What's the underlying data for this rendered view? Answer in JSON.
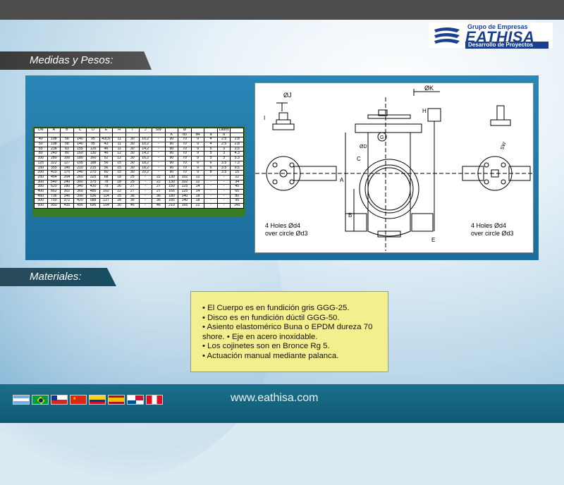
{
  "brand": {
    "group": "Grupo de Empresas",
    "name": "EATHISA",
    "sub": "Desarrollo de Proyectos"
  },
  "sections": {
    "medidas": "Medidas y Pesos:",
    "materiales": "Materiales:"
  },
  "table": {
    "headers1": [
      "DN",
      "A",
      "B",
      "C",
      "D",
      "E",
      "H",
      "I",
      "J",
      "SW",
      "",
      "Ø",
      "",
      "",
      "Lados",
      "",
      "Peso"
    ],
    "headers2": [
      "",
      "",
      "",
      "",
      "",
      "",
      "",
      "",
      "",
      "",
      "K",
      "d3",
      "d4",
      "a",
      "b",
      ""
    ],
    "rows": [
      [
        "40",
        "198",
        "58",
        "140",
        "95",
        "43(3)",
        "11",
        "30",
        "10,2",
        "-",
        "90",
        "70",
        "9",
        "4",
        "2.5",
        "2.8"
      ],
      [
        "50",
        "198",
        "58",
        "140",
        "95",
        "43",
        "11",
        "30",
        "10,2",
        "-",
        "90",
        "70",
        "9",
        "4",
        "2.5",
        "2.8"
      ],
      [
        "65",
        "238",
        "83",
        "155",
        "126",
        "46",
        "11",
        "30",
        "14,2",
        "-",
        "90",
        "70",
        "9",
        "5",
        "3",
        "3.5"
      ],
      [
        "80",
        "240",
        "80",
        "160",
        "130",
        "46",
        "12",
        "30",
        "14,2",
        "-",
        "90",
        "70",
        "9",
        "5",
        "3",
        "4.3"
      ],
      [
        "100",
        "280",
        "100",
        "180",
        "160",
        "52",
        "12",
        "30",
        "16,2",
        "-",
        "90",
        "70",
        "9",
        "5",
        "3",
        "5.3"
      ],
      [
        "125",
        "322",
        "127",
        "195",
        "188",
        "56",
        "15",
        "30",
        "18,2",
        "-",
        "90",
        "70",
        "9",
        "6",
        "3.5",
        "7.3"
      ],
      [
        "150",
        "355",
        "145",
        "210",
        "215",
        "56",
        "15",
        "30",
        "18,2",
        "-",
        "90",
        "70",
        "9",
        "6",
        "3.5",
        "9.5"
      ],
      [
        "200",
        "410",
        "170",
        "240",
        "270",
        "60",
        "15",
        "30",
        "20,2",
        "-",
        "90",
        "70",
        "9",
        "8",
        "3.5",
        "15"
      ],
      [
        "250",
        "464",
        "204",
        "260",
        "325",
        "68",
        "18",
        "25",
        "-",
        "22",
        "130",
        "102",
        "12",
        "-",
        "-",
        "22"
      ],
      [
        "300",
        "540",
        "240",
        "300",
        "375",
        "78",
        "18",
        "25",
        "-",
        "22",
        "130",
        "102",
        "12",
        "-",
        "-",
        "34"
      ],
      [
        "350",
        "620",
        "280",
        "340",
        "430",
        "78",
        "26",
        "27",
        "-",
        "27",
        "150",
        "125",
        "14",
        "-",
        "-",
        "45"
      ],
      [
        "400",
        "662",
        "302",
        "360",
        "485",
        "102",
        "22",
        "27",
        "-",
        "27",
        "165",
        "125",
        "14",
        "-",
        "-",
        "65"
      ],
      [
        "450",
        "736",
        "346",
        "390",
        "536",
        "114",
        "25",
        "36",
        "-",
        "36",
        "180",
        "140",
        "18",
        "-",
        "-",
        "80"
      ],
      [
        "500",
        "750",
        "372",
        "420",
        "588",
        "127",
        "28",
        "36",
        "-",
        "36",
        "185",
        "140",
        "18",
        "-",
        "-",
        "95"
      ],
      [
        "600",
        "950",
        "435",
        "495",
        "696",
        "154",
        "30",
        "46",
        "-",
        "46",
        "210",
        "165",
        "22",
        "-",
        "-",
        "145"
      ]
    ]
  },
  "drawing": {
    "label_j": "ØJ",
    "label_k": "ØK",
    "label_h": "H",
    "label_i": "I",
    "label_a": "A",
    "label_b": "B",
    "label_c": "C",
    "label_e": "E",
    "label_d": "ØD",
    "label_g": "G",
    "label_sw": "SW",
    "holes_left_1": "4 Holes Ød4",
    "holes_left_2": "over circle Ød3",
    "holes_right_1": "4 Holes Ød4",
    "holes_right_2": "over circle Ød3"
  },
  "materials": [
    "• El Cuerpo es en fundición gris GGG-25.",
    "• Disco es en fundición dúctil GGG-50.",
    "• Asiento elastomérico Buna o EPDM dureza 70 shore. • Eje en acero inoxidable.",
    "• Los cojinetes son en Bronce Rg 5.",
    "• Actuación manual mediante palanca."
  ],
  "footer": {
    "url": "www.eathisa.com",
    "flags": [
      "argentina-flag",
      "brazil-flag",
      "chile-flag",
      "china-flag",
      "colombia-flag",
      "spain-flag",
      "panama-flag",
      "peru-flag"
    ]
  },
  "colors": {
    "brand_blue": "#1a3f8f",
    "panel_blue": "#2a86b6",
    "table_green": "#3a7a25",
    "note_yellow": "#f3ef8e",
    "footer_teal": "#0e5a74"
  }
}
